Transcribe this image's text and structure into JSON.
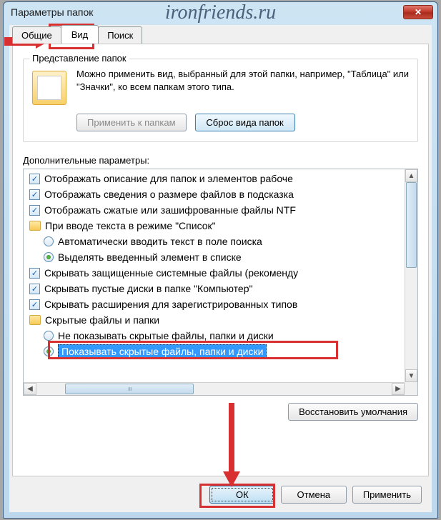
{
  "watermark": "ironfriends.ru",
  "window": {
    "title": "Параметры папок"
  },
  "tabs": {
    "general": "Общие",
    "view": "Вид",
    "search": "Поиск"
  },
  "folderviews": {
    "legend": "Представление папок",
    "desc": "Можно применить вид, выбранный для этой папки, например, \"Таблица\" или \"Значки\", ко всем папкам этого типа.",
    "apply": "Применить к папкам",
    "reset": "Сброс вида папок"
  },
  "advanced_label": "Дополнительные параметры:",
  "items": {
    "i0": "Отображать описание для папок и элементов рабоче",
    "i1": "Отображать сведения о размере файлов в подсказка",
    "i2": "Отображать сжатые или зашифрованные файлы NTF",
    "i3": "При вводе текста в режиме \"Список\"",
    "i3a": "Автоматически вводить текст в поле поиска",
    "i3b": "Выделять введенный элемент в списке",
    "i4": "Скрывать защищенные системные файлы (рекоменду",
    "i5": "Скрывать пустые диски в папке \"Компьютер\"",
    "i6": "Скрывать расширения для зарегистрированных типов",
    "i7": "Скрытые файлы и папки",
    "i7a": "Не показывать скрытые файлы, папки и диски",
    "i7b": "Показывать скрытые файлы, папки и диски"
  },
  "restore": "Восстановить умолчания",
  "buttons": {
    "ok": "ОК",
    "cancel": "Отмена",
    "apply": "Применить"
  }
}
